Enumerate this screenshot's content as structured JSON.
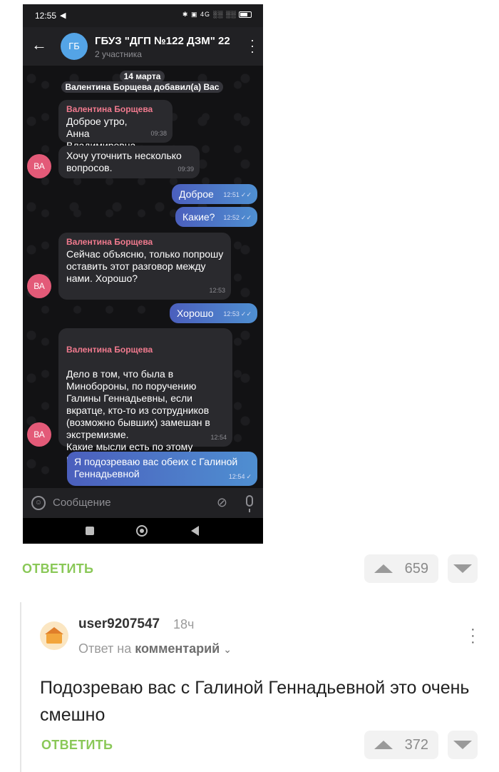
{
  "phone": {
    "status_bar": {
      "time": "12:55",
      "icons": "✱ ▣ 4G ░░ ░░"
    },
    "header": {
      "avatar_initials": "ГБ",
      "avatar_color": "#54a4e6",
      "title": "ГБУЗ \"ДГП №122 ДЗМ\" 22",
      "subtitle": "2 участника"
    },
    "chat": {
      "date": "14 марта",
      "service_message": "Валентина Борщева добавил(а) Вас",
      "sender_avatar_initials": "ВА",
      "messages": [
        {
          "dir": "in",
          "sender": "Валентина Борщева",
          "text": "Доброе утро, Анна Владимировна.",
          "time": "09:38"
        },
        {
          "dir": "in",
          "sender": "",
          "text": "Хочу уточнить несколько вопросов.",
          "time": "09:39"
        },
        {
          "dir": "out",
          "text": "Доброе",
          "time": "12:51"
        },
        {
          "dir": "out",
          "text": "Какие?",
          "time": "12:52"
        },
        {
          "dir": "in",
          "sender": "Валентина Борщева",
          "text": "Сейчас объясню, только попрошу оставить этот разговор между нами. Хорошо?",
          "time": "12:53"
        },
        {
          "dir": "out",
          "text": "Хорошо",
          "time": "12:53"
        },
        {
          "dir": "in",
          "sender": "Валентина Борщева",
          "text": "Дело в том, что была в Минобороны, по поручению Галины Геннадьевны, если вкратце, кто-то из сотрудников (возможно бывших) замешан в экстремизме.\nКакие мысли есть по этому поводу?",
          "time": "12:54"
        },
        {
          "dir": "out",
          "text": "Я подозреваю вас обеих с Галиной Геннадьевной",
          "time": "12:54"
        }
      ]
    },
    "input": {
      "placeholder": "Сообщение"
    }
  },
  "post_actions": {
    "reply_label": "ОТВЕТИТЬ",
    "rating": "659"
  },
  "comment": {
    "username": "user9207547",
    "time_ago": "18ч",
    "reply_prefix": "Ответ на",
    "reply_target": "комментарий",
    "text": "Подозреваю вас с Галиной Геннадьевной это очень смешно",
    "reply_label": "ОТВЕТИТЬ",
    "rating": "372"
  },
  "colors": {
    "reply_green": "#8ac858",
    "sender_pink": "#f07a8e",
    "outgoing_bubble": "#4b5fbd"
  }
}
